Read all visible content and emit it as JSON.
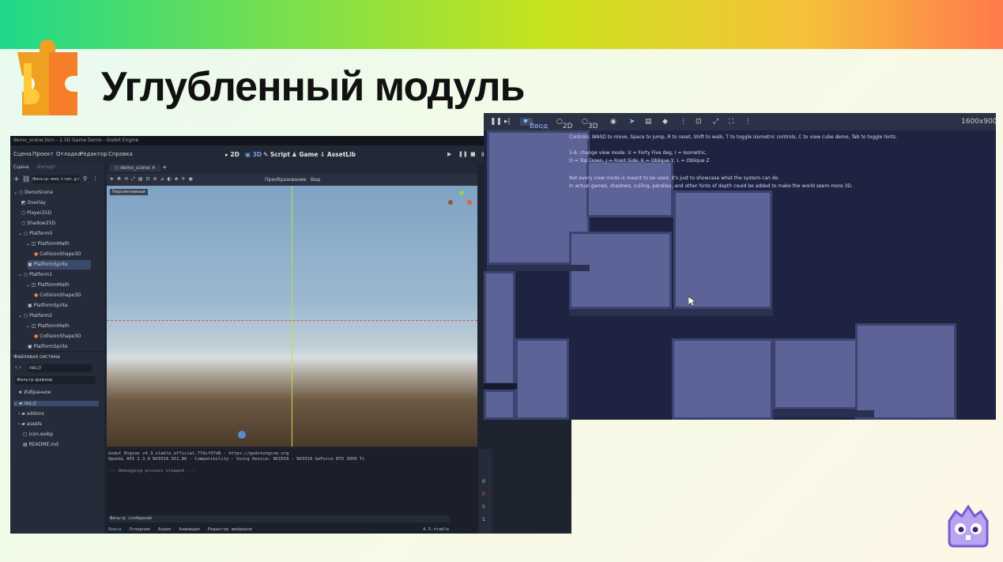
{
  "slide": {
    "title": "Углубленный модуль"
  },
  "editor": {
    "window_title": "demo_scene.tscn - 2.5D Game Demo - Godot Engine",
    "menu": [
      "Сцена",
      "Проект",
      "Отладка",
      "Редактор",
      "Справка"
    ],
    "workspaces": [
      "2D",
      "3D",
      "Script",
      "Game",
      "AssetLib"
    ],
    "dock_tabs": [
      "Сцена",
      "Импорт"
    ],
    "filter_placeholder": "Фильтр: имя, t:тип, g:группа",
    "scene_tree": [
      "DemoScene",
      "Overlay",
      "Player25D",
      "Shadow25D",
      "Platform0",
      "PlatformMath",
      "CollisionShape3D",
      "PlatformSprite",
      "Platform1",
      "PlatformMath",
      "CollisionShape3D",
      "PlatformSprite",
      "Platform2",
      "PlatformMath",
      "CollisionShape3D",
      "PlatformSprite"
    ],
    "scene_tab": "demo_scene",
    "viewport_menu": [
      "Преобразование",
      "Вид"
    ],
    "viewport_label": "Перспективный",
    "filesystem_title": "Файловая система",
    "path": "res://",
    "filesystem_filter": "Фильтр файлов",
    "files": [
      "Избранное",
      "res://",
      "addons",
      "assets",
      "icon.webp",
      "README.md"
    ],
    "output_lines": [
      "Godot Engine v4.3.stable.official.77dcf97d8 - https://godotengine.org",
      "OpenGL API 3.3.0 NVIDIA 551.86 - Compatibility - Using Device: NVIDIA - NVIDIA GeForce RTX 3050 Ti",
      "--- Debugging process stopped ---"
    ],
    "output_filter": "Фильтр сообщений",
    "bottom_tabs": [
      "Вывод",
      "Отладчик",
      "Аудио",
      "Анимация",
      "Редактор шейдеров"
    ],
    "version": "4.3.stable",
    "output_counts": [
      "0",
      "0",
      "0",
      "1"
    ]
  },
  "game": {
    "toolbar": [
      "Ввод",
      "2D",
      "3D"
    ],
    "resolution": "1600x900",
    "hints": [
      "Controls: WASD to move, Space to jump, R to reset, Shift to walk, T to toggle isometric controls, C to view cube demo, Tab to toggle hints.",
      "1-6: change view mode. U = Forty Five deg, I = Isometric,",
      "O = Top Down, J = Front Side, K = Oblique Y, L = Oblique Z",
      "Not every view mode is meant to be used, it's just to showcase what the system can do.",
      "In actual games, shadows, culling, parallax, and other hints of depth could be added to make the world seem more 3D."
    ]
  },
  "colors": {
    "game_bg": "#1d2340",
    "tile": "#5c6396",
    "tile_border": "#3b4370",
    "godot_blue": "#478cbf"
  }
}
